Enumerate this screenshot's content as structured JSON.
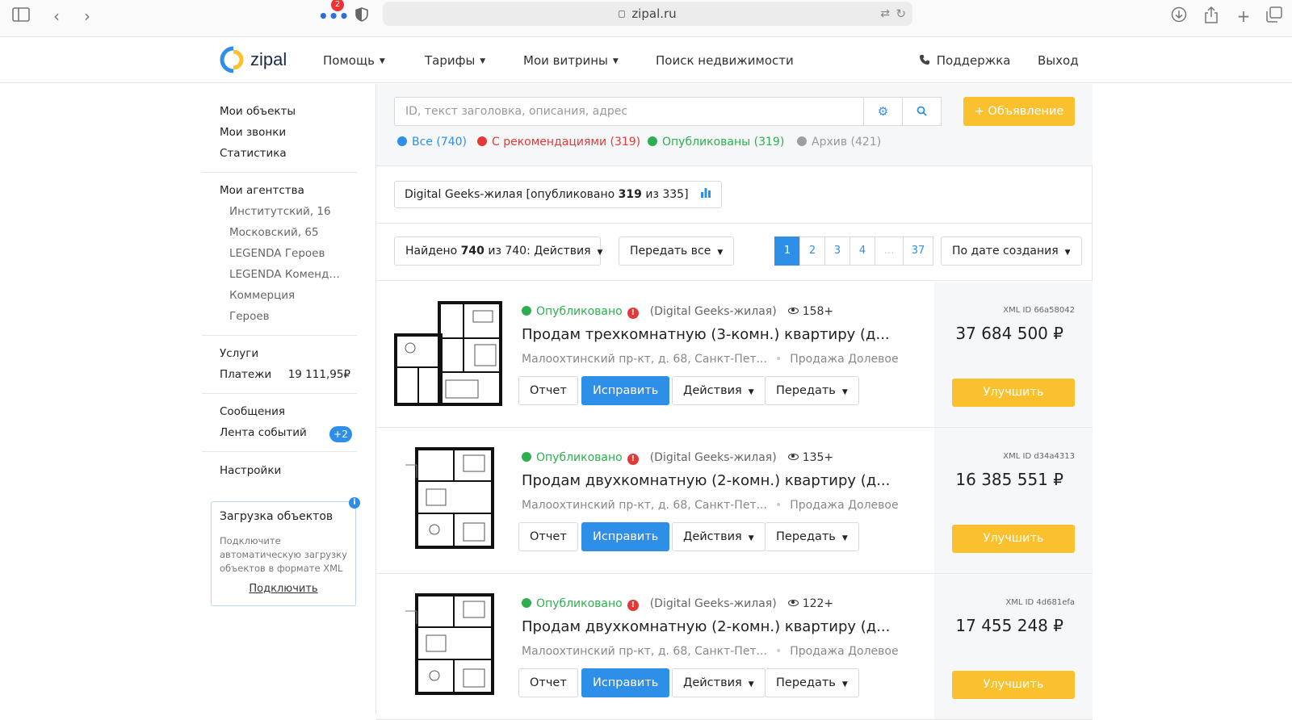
{
  "browser": {
    "url": "zipal.ru",
    "notifications": "2"
  },
  "header": {
    "logo_text": "zipal",
    "nav": [
      "Помощь",
      "Тарифы",
      "Мои витрины",
      "Поиск недвижимости"
    ],
    "support": "Поддержка",
    "logout": "Выход"
  },
  "sidebar": {
    "group1": [
      "Мои объекты",
      "Мои звонки",
      "Статистика"
    ],
    "agencies_title": "Мои агентства",
    "agencies": [
      "Институтский, 16",
      "Московский, 65",
      "LEGENDA Героев",
      "LEGENDA Коменд…",
      "Коммерция",
      "Героев"
    ],
    "services": "Услуги",
    "payments": "Платежи",
    "payments_value": "19 111,95₽",
    "messages": "Сообщения",
    "events": "Лента событий",
    "events_badge": "+2",
    "settings": "Настройки",
    "upload": {
      "title": "Загрузка объектов",
      "desc": "Подключите автоматическую загрузку объектов в формате XML",
      "link": "Подключить"
    }
  },
  "search": {
    "placeholder": "ID, текст заголовка, описания, адрес",
    "add_label": "+ Объявление"
  },
  "filters": [
    {
      "label": "Все (740)",
      "color": "#2d8fe8"
    },
    {
      "label": "С рекомендациями (319)",
      "color": "#e53935"
    },
    {
      "label": "Опубликованы (319)",
      "color": "#2eaf4f"
    },
    {
      "label": "Архив (421)",
      "color": "#9e9e9e"
    }
  ],
  "agency_chip": {
    "prefix": "Digital Geeks-жилая [опубликовано ",
    "published": "319",
    "suffix": " из 335]"
  },
  "toolbar": {
    "found_prefix": "Найдено ",
    "found_count": "740",
    "found_suffix": " из 740: Действия",
    "transfer_all": "Передать все",
    "pages": [
      "1",
      "2",
      "3",
      "4",
      "…",
      "37"
    ],
    "sort": "По дате создания"
  },
  "listings": [
    {
      "status": "Опубликовано",
      "agency": "(Digital Geeks-жилая)",
      "views": "158+",
      "title": "Продам трехкомнатную (3-комн.) квартиру (д...",
      "address": "Малоохтинский пр-кт, д. 68, Санкт-Пет...",
      "deal": "Продажа Долевое",
      "xml_id": "XML ID 66a58042",
      "price": "37 684 500",
      "currency": "₽"
    },
    {
      "status": "Опубликовано",
      "agency": "(Digital Geeks-жилая)",
      "views": "135+",
      "title": "Продам двухкомнатную (2-комн.) квартиру (д...",
      "address": "Малоохтинский пр-кт, д. 68, Санкт-Пет...",
      "deal": "Продажа Долевое",
      "xml_id": "XML ID d34a4313",
      "price": "16 385 551",
      "currency": "₽"
    },
    {
      "status": "Опубликовано",
      "agency": "(Digital Geeks-жилая)",
      "views": "122+",
      "title": "Продам двухкомнатную (2-комн.) квартиру (д...",
      "address": "Малоохтинский пр-кт, д. 68, Санкт-Пет...",
      "deal": "Продажа Долевое",
      "xml_id": "XML ID 4d681efa",
      "price": "17 455 248",
      "currency": "₽"
    }
  ],
  "listing_actions": {
    "report": "Отчет",
    "fix": "Исправить",
    "actions": "Действия",
    "transfer": "Передать",
    "improve": "Улучшить"
  },
  "colors": {
    "accent": "#2d8fe8",
    "yellow": "#fbc02d",
    "published": "#2eaf4f",
    "warning": "#e53935"
  }
}
